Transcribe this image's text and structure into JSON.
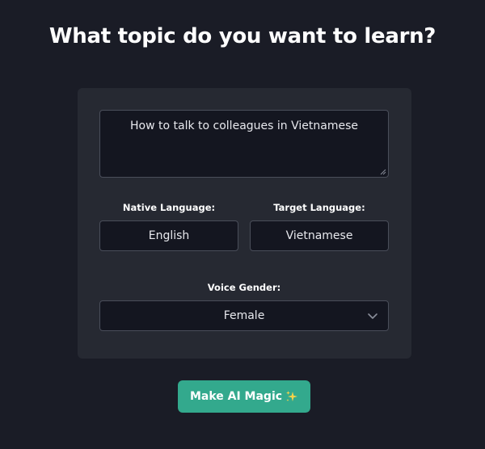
{
  "heading": "What topic do you want to learn?",
  "form": {
    "topic_value": "How to talk to colleagues in Vietnamese",
    "native_language_label": "Native Language:",
    "native_language_value": "English",
    "target_language_label": "Target Language:",
    "target_language_value": "Vietnamese",
    "voice_gender_label": "Voice Gender:",
    "voice_gender_value": "Female"
  },
  "submit_button": {
    "label": "Make AI Magic",
    "icon": "sparkles-icon"
  },
  "colors": {
    "background": "#1a1c26",
    "card": "#262932",
    "input_background": "#141620",
    "input_border": "#4a4e5a",
    "accent": "#33a98d",
    "sparkle": "#f5d34a"
  }
}
